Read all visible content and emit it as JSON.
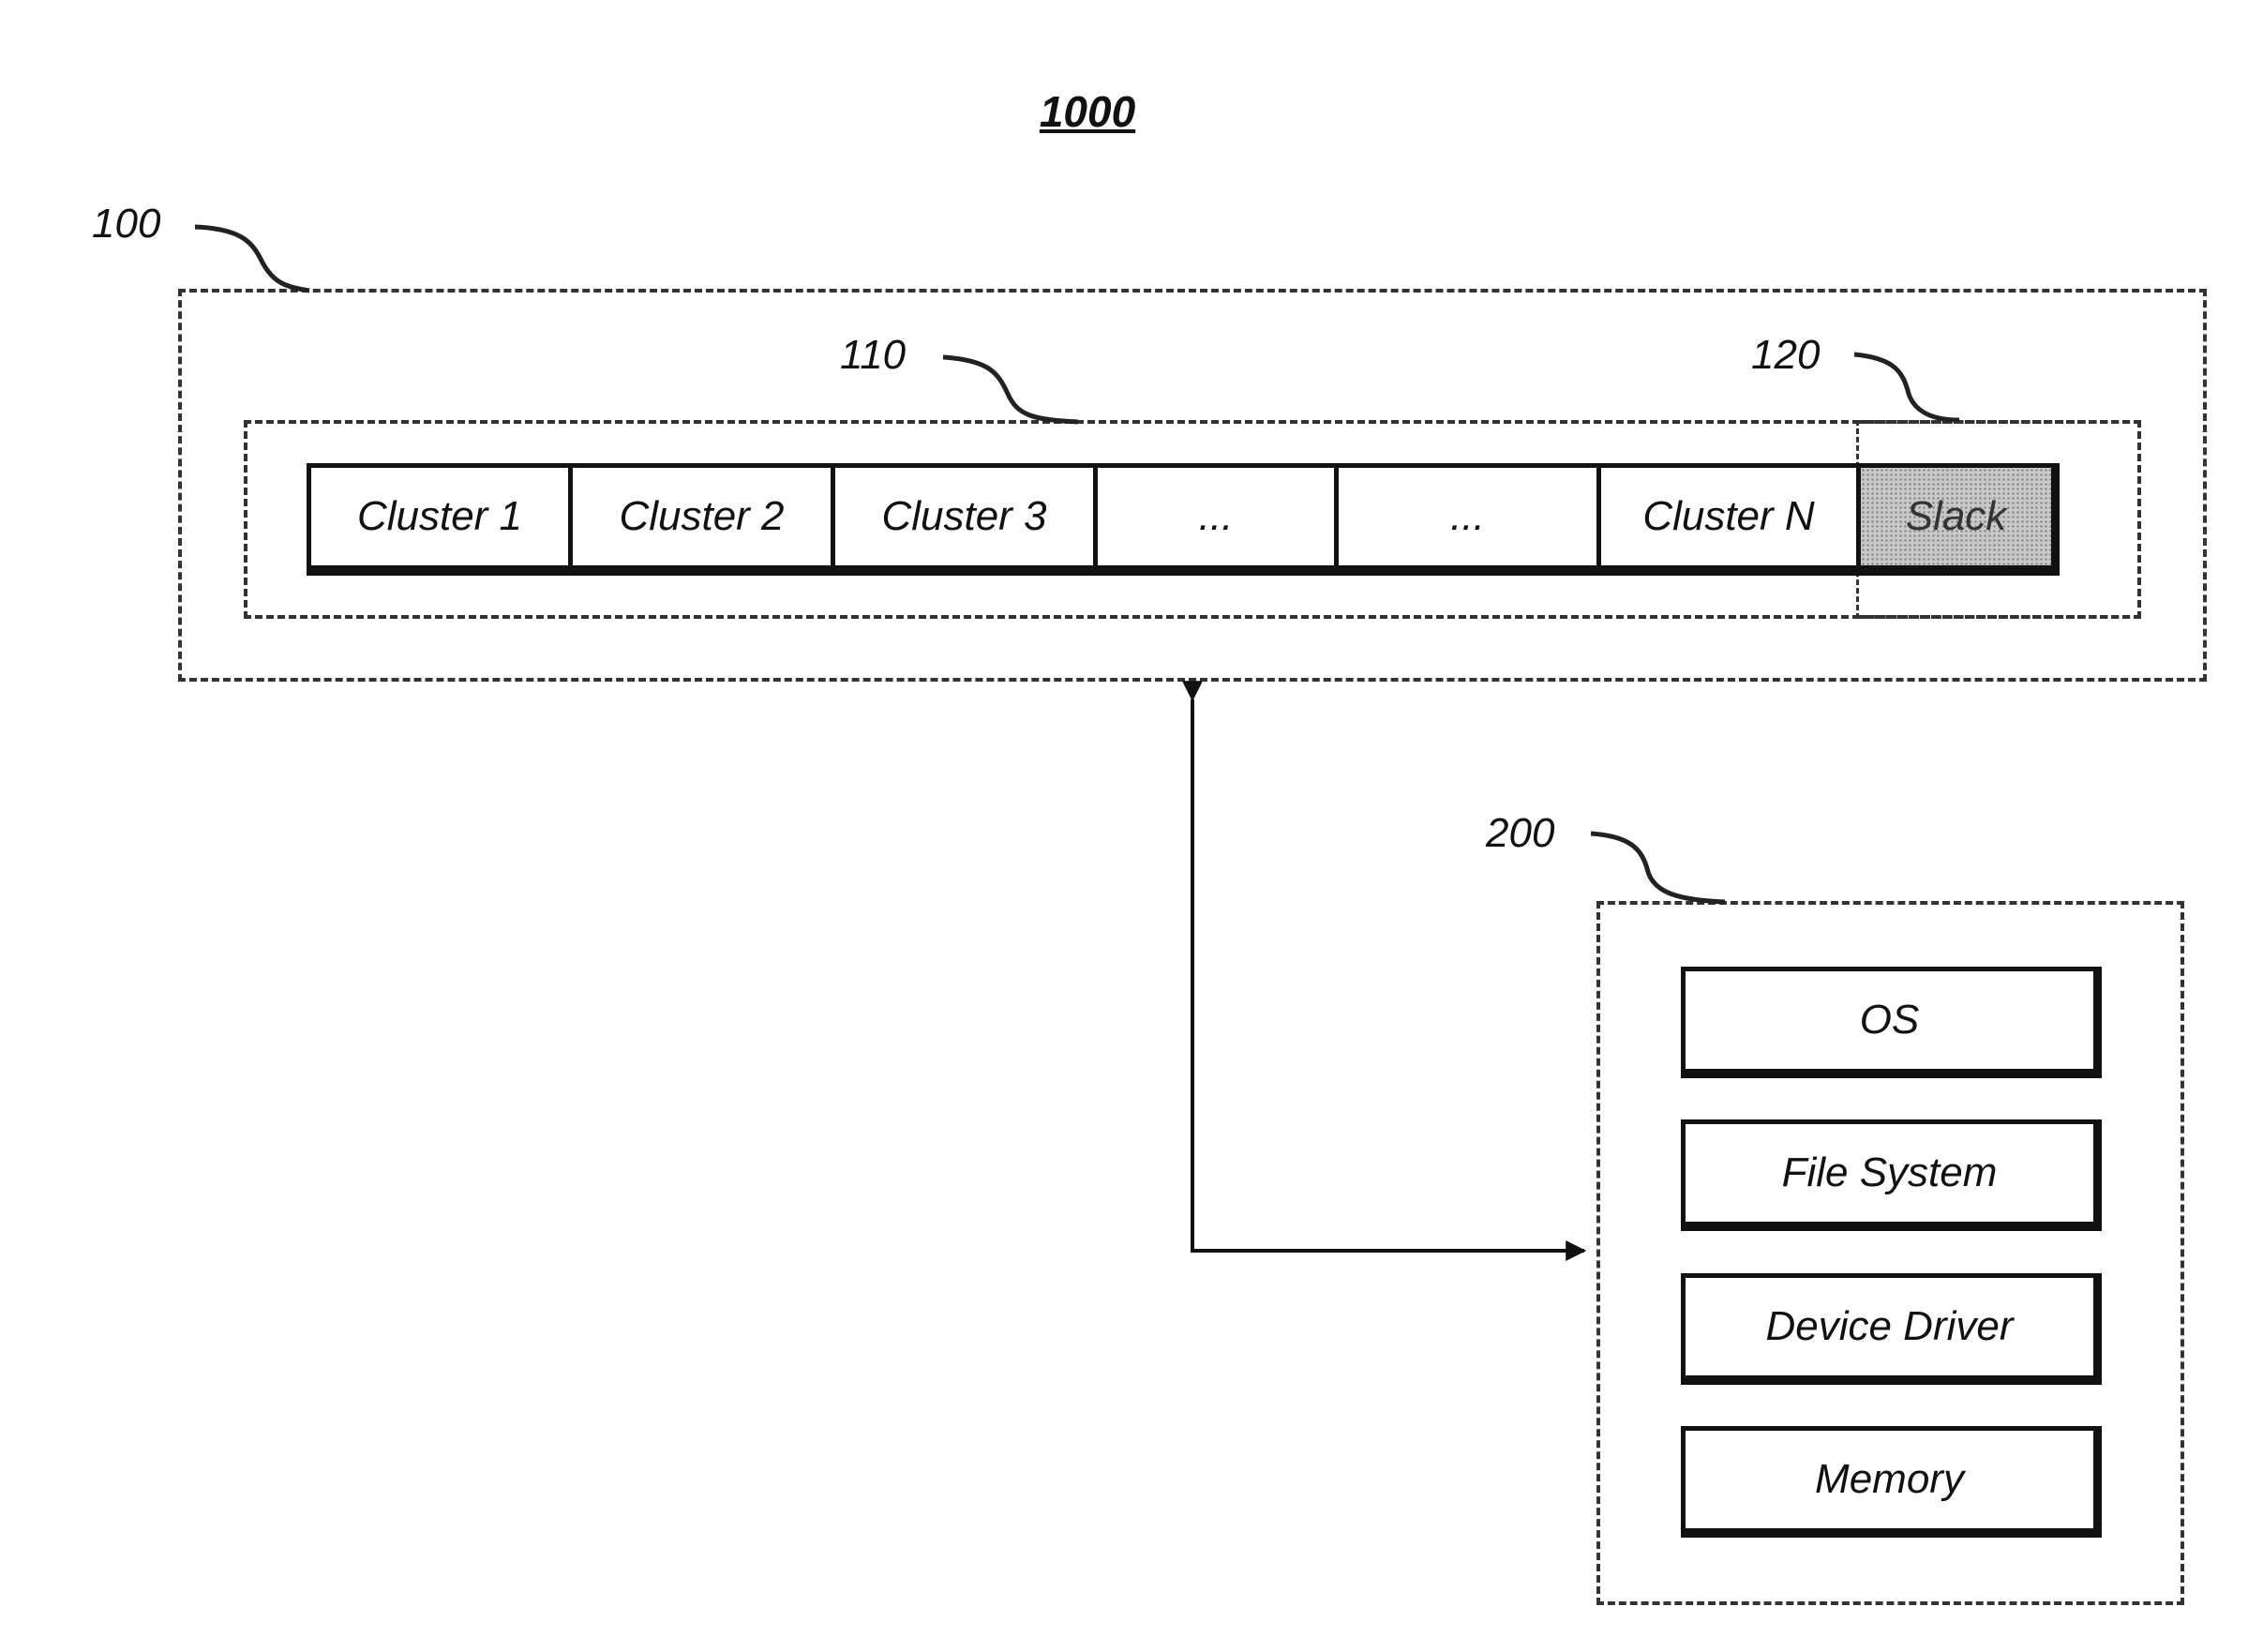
{
  "figure": {
    "title": "1000",
    "refs": {
      "system": "100",
      "clusters": "110",
      "slack": "120",
      "host": "200"
    },
    "clusters": [
      {
        "label": "Cluster 1",
        "type": "cluster"
      },
      {
        "label": "Cluster 2",
        "type": "cluster"
      },
      {
        "label": "Cluster 3",
        "type": "cluster"
      },
      {
        "label": "...",
        "type": "ellipsis"
      },
      {
        "label": "...",
        "type": "ellipsis"
      },
      {
        "label": "Cluster N",
        "type": "cluster"
      },
      {
        "label": "Slack",
        "type": "slack"
      }
    ],
    "host_components": [
      "OS",
      "File System",
      "Device Driver",
      "Memory"
    ],
    "connection": "bidirectional"
  }
}
